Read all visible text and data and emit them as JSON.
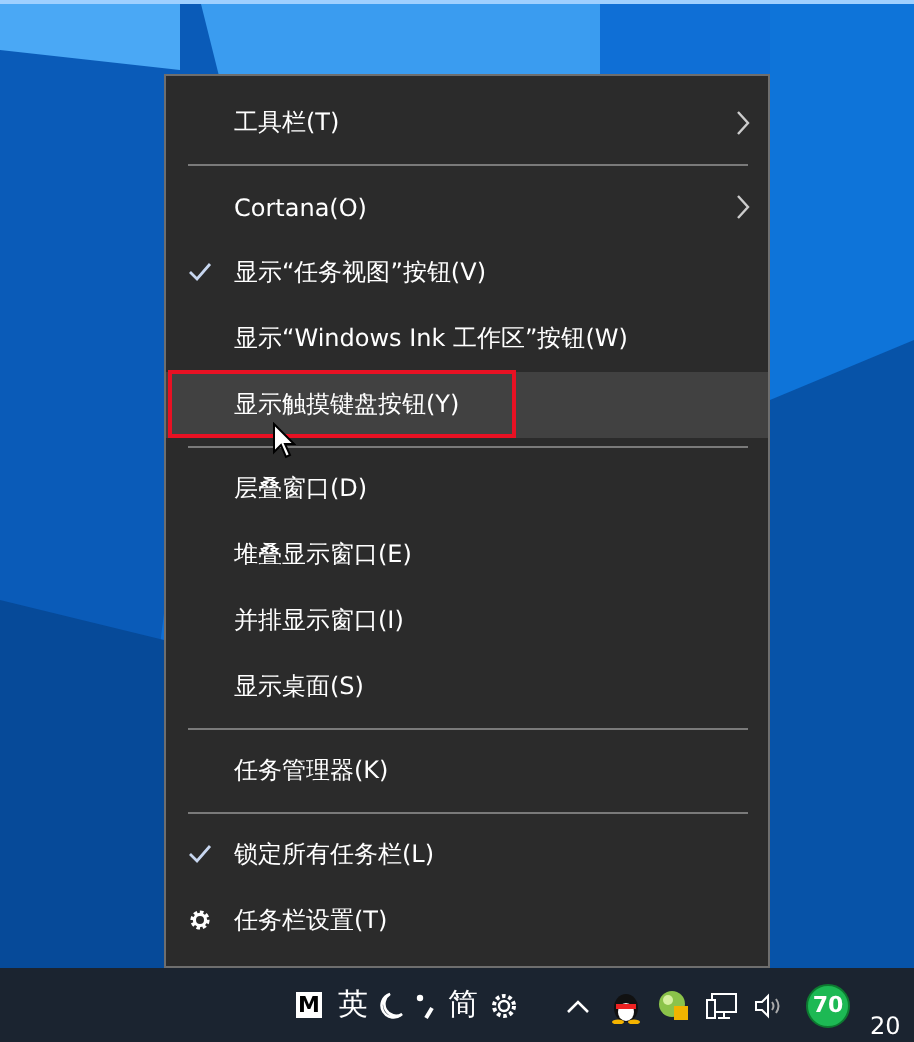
{
  "menu": {
    "items": [
      {
        "kind": "item",
        "label": "工具栏(T)",
        "checked": false,
        "submenu": true,
        "selected": false,
        "outlined": false
      },
      {
        "kind": "separator"
      },
      {
        "kind": "item",
        "label": "Cortana(O)",
        "checked": false,
        "submenu": true,
        "selected": false,
        "outlined": false
      },
      {
        "kind": "item",
        "label": "显示“任务视图”按钮(V)",
        "checked": true,
        "submenu": false,
        "selected": false,
        "outlined": false
      },
      {
        "kind": "item",
        "label": "显示“Windows Ink 工作区”按钮(W)",
        "checked": false,
        "submenu": false,
        "selected": false,
        "outlined": false
      },
      {
        "kind": "item",
        "label": "显示触摸键盘按钮(Y)",
        "checked": false,
        "submenu": false,
        "selected": true,
        "outlined": true
      },
      {
        "kind": "separator"
      },
      {
        "kind": "item",
        "label": "层叠窗口(D)",
        "checked": false,
        "submenu": false,
        "selected": false,
        "outlined": false
      },
      {
        "kind": "item",
        "label": "堆叠显示窗口(E)",
        "checked": false,
        "submenu": false,
        "selected": false,
        "outlined": false
      },
      {
        "kind": "item",
        "label": "并排显示窗口(I)",
        "checked": false,
        "submenu": false,
        "selected": false,
        "outlined": false
      },
      {
        "kind": "item",
        "label": "显示桌面(S)",
        "checked": false,
        "submenu": false,
        "selected": false,
        "outlined": false
      },
      {
        "kind": "separator"
      },
      {
        "kind": "item",
        "label": "任务管理器(K)",
        "checked": false,
        "submenu": false,
        "selected": false,
        "outlined": false
      },
      {
        "kind": "separator"
      },
      {
        "kind": "item",
        "label": "锁定所有任务栏(L)",
        "checked": true,
        "submenu": false,
        "selected": false,
        "outlined": false
      },
      {
        "kind": "setting",
        "label": "任务栏设置(T)",
        "checked": false,
        "submenu": false,
        "selected": false,
        "outlined": false
      }
    ]
  },
  "taskbar": {
    "input_mode": "M",
    "language": "英",
    "script": "简",
    "badge": "70",
    "clock": "20"
  }
}
